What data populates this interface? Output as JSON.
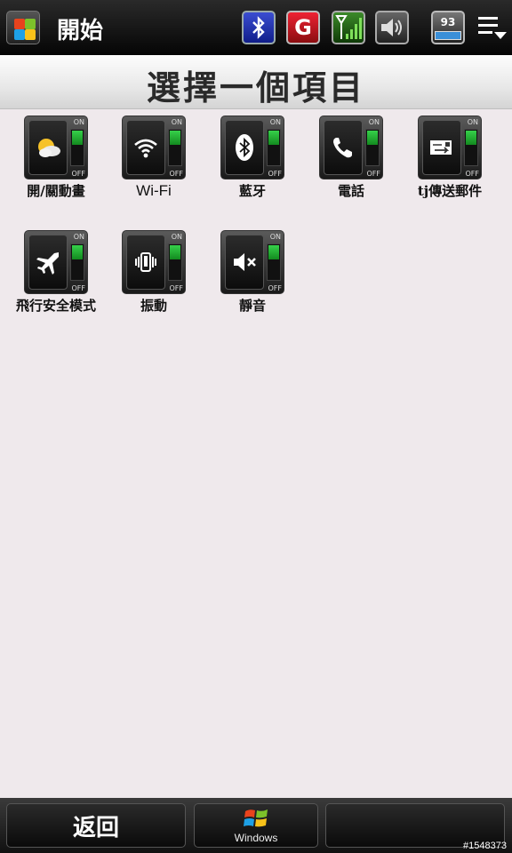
{
  "status_bar": {
    "title": "開始",
    "g_label": "G",
    "battery_percent": "93"
  },
  "header": {
    "title": "選擇一個項目"
  },
  "toggle_labels": {
    "on": "ON",
    "off": "OFF"
  },
  "toggles": [
    {
      "label": "開/關動畫",
      "icon": "weather-animation-icon",
      "state": "ON"
    },
    {
      "label": "Wi-Fi",
      "icon": "wifi-icon",
      "state": "ON"
    },
    {
      "label": "藍牙",
      "icon": "bluetooth-icon",
      "state": "ON"
    },
    {
      "label": "電話",
      "icon": "phone-icon",
      "state": "ON"
    },
    {
      "label": "tj傳送郵件",
      "icon": "send-mail-icon",
      "state": "ON"
    },
    {
      "label": "飛行安全模式",
      "icon": "airplane-icon",
      "state": "ON"
    },
    {
      "label": "振動",
      "icon": "vibrate-icon",
      "state": "ON"
    },
    {
      "label": "靜音",
      "icon": "mute-icon",
      "state": "ON"
    }
  ],
  "bottom_bar": {
    "back_label": "返回",
    "windows_label": "Windows"
  },
  "watermark": "#1548373",
  "colors": {
    "toggle_on": "#22b33a",
    "header_bg": "#e8e8e8",
    "page_bg": "#efe9ec"
  }
}
